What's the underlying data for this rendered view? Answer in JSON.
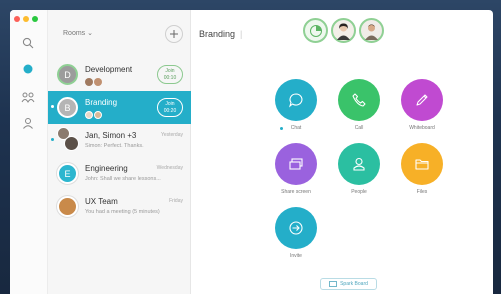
{
  "colors": {
    "accent": "#24aec9",
    "chat": "#24aec9",
    "call": "#3ac36a",
    "whiteboard": "#c04ad1",
    "share": "#9a62de",
    "people": "#2bbfa1",
    "files": "#f7b027",
    "invite": "#24aec9"
  },
  "rooms": {
    "header": "Rooms",
    "items": [
      {
        "name": "Development",
        "initial": "D",
        "join": "Join",
        "join_time": "00:10"
      },
      {
        "name": "Branding",
        "initial": "B",
        "join": "Join",
        "join_time": "00:20"
      },
      {
        "name": "Jan, Simon +3",
        "time": "Yesterday",
        "sub": "Simon: Perfect. Thanks."
      },
      {
        "name": "Engineering",
        "initial": "E",
        "time": "Wednesday",
        "sub": "John: Shall we share lessons..."
      },
      {
        "name": "UX Team",
        "time": "Friday",
        "sub": "You had a meeting (5 minutes)"
      }
    ]
  },
  "main": {
    "title": "Branding",
    "actions": {
      "chat": "Chat",
      "call": "Call",
      "whiteboard": "Whiteboard",
      "share": "Share screen",
      "people": "People",
      "files": "Files",
      "invite": "Invite"
    },
    "spark_board": "Spark Board"
  }
}
